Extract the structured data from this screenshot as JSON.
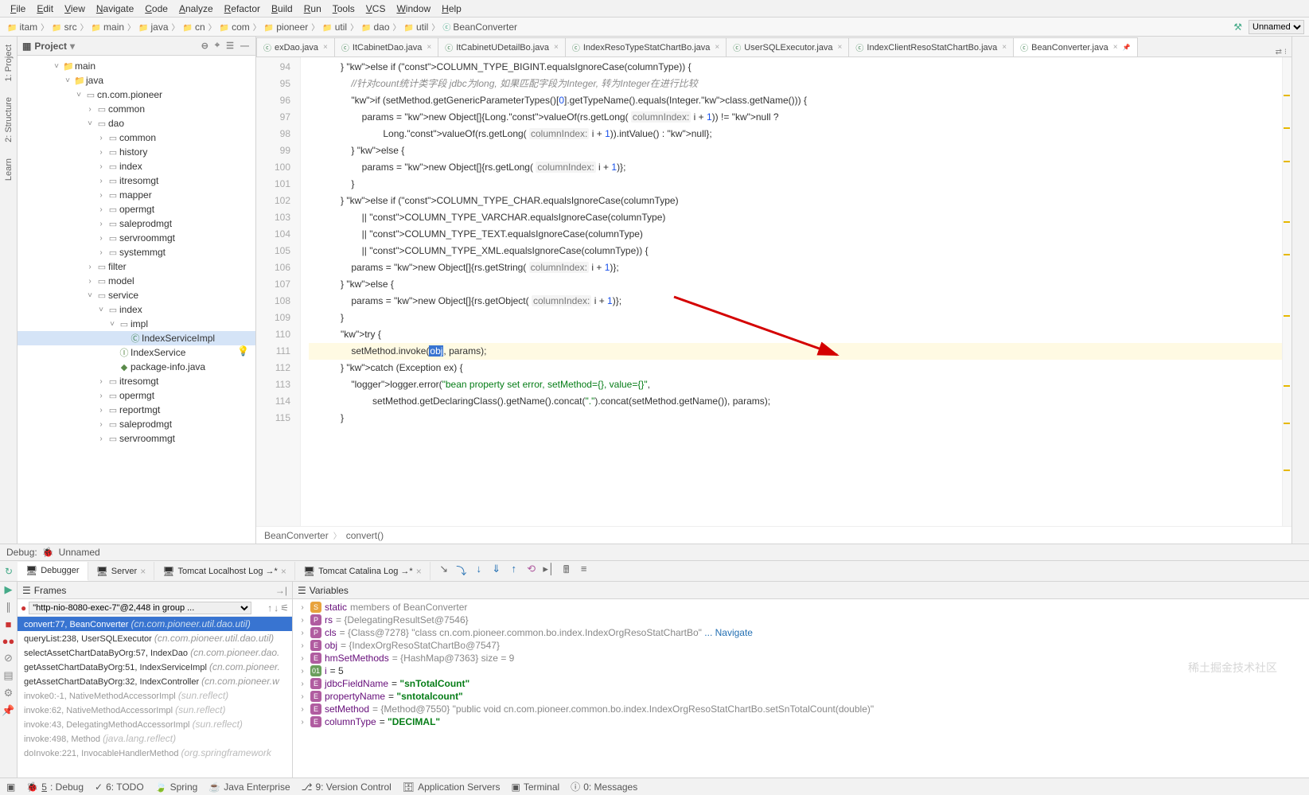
{
  "menu": [
    "File",
    "Edit",
    "View",
    "Navigate",
    "Code",
    "Analyze",
    "Refactor",
    "Build",
    "Run",
    "Tools",
    "VCS",
    "Window",
    "Help"
  ],
  "breadcrumb": {
    "items": [
      {
        "icon": "folder",
        "label": "itam"
      },
      {
        "icon": "folder",
        "label": "src"
      },
      {
        "icon": "folder",
        "label": "main"
      },
      {
        "icon": "folder",
        "label": "java"
      },
      {
        "icon": "folder",
        "label": "cn"
      },
      {
        "icon": "folder",
        "label": "com"
      },
      {
        "icon": "folder",
        "label": "pioneer"
      },
      {
        "icon": "folder",
        "label": "util"
      },
      {
        "icon": "folder",
        "label": "dao"
      },
      {
        "icon": "folder",
        "label": "util"
      },
      {
        "icon": "class",
        "label": "BeanConverter"
      }
    ],
    "run_config": "Unnamed"
  },
  "project": {
    "title": "Project",
    "tree": [
      {
        "depth": 3,
        "exp": "v",
        "ico": "folder",
        "label": "main"
      },
      {
        "depth": 4,
        "exp": "v",
        "ico": "folder",
        "label": "java"
      },
      {
        "depth": 5,
        "exp": "v",
        "ico": "pkg",
        "label": "cn.com.pioneer"
      },
      {
        "depth": 6,
        "exp": ">",
        "ico": "pkg",
        "label": "common"
      },
      {
        "depth": 6,
        "exp": "v",
        "ico": "pkg",
        "label": "dao"
      },
      {
        "depth": 7,
        "exp": ">",
        "ico": "pkg",
        "label": "common"
      },
      {
        "depth": 7,
        "exp": ">",
        "ico": "pkg",
        "label": "history"
      },
      {
        "depth": 7,
        "exp": ">",
        "ico": "pkg",
        "label": "index"
      },
      {
        "depth": 7,
        "exp": ">",
        "ico": "pkg",
        "label": "itresomgt"
      },
      {
        "depth": 7,
        "exp": ">",
        "ico": "pkg",
        "label": "mapper"
      },
      {
        "depth": 7,
        "exp": ">",
        "ico": "pkg",
        "label": "opermgt"
      },
      {
        "depth": 7,
        "exp": ">",
        "ico": "pkg",
        "label": "saleprodmgt"
      },
      {
        "depth": 7,
        "exp": ">",
        "ico": "pkg",
        "label": "servroommgt"
      },
      {
        "depth": 7,
        "exp": ">",
        "ico": "pkg",
        "label": "systemmgt"
      },
      {
        "depth": 6,
        "exp": ">",
        "ico": "pkg",
        "label": "filter"
      },
      {
        "depth": 6,
        "exp": ">",
        "ico": "pkg",
        "label": "model"
      },
      {
        "depth": 6,
        "exp": "v",
        "ico": "pkg",
        "label": "service"
      },
      {
        "depth": 7,
        "exp": "v",
        "ico": "pkg",
        "label": "index"
      },
      {
        "depth": 8,
        "exp": "v",
        "ico": "pkg",
        "label": "impl"
      },
      {
        "depth": 9,
        "exp": "",
        "ico": "class",
        "label": "IndexServiceImpl",
        "sel": true
      },
      {
        "depth": 8,
        "exp": "",
        "ico": "int",
        "label": "IndexService"
      },
      {
        "depth": 8,
        "exp": "",
        "ico": "java",
        "label": "package-info.java"
      },
      {
        "depth": 7,
        "exp": ">",
        "ico": "pkg",
        "label": "itresomgt"
      },
      {
        "depth": 7,
        "exp": ">",
        "ico": "pkg",
        "label": "opermgt"
      },
      {
        "depth": 7,
        "exp": ">",
        "ico": "pkg",
        "label": "reportmgt"
      },
      {
        "depth": 7,
        "exp": ">",
        "ico": "pkg",
        "label": "saleprodmgt"
      },
      {
        "depth": 7,
        "exp": ">",
        "ico": "pkg",
        "label": "servroommgt"
      }
    ]
  },
  "tabs": [
    {
      "label": "exDao.java"
    },
    {
      "label": "ItCabinetDao.java"
    },
    {
      "label": "ItCabinetUDetailBo.java"
    },
    {
      "label": "IndexResoTypeStatChartBo.java"
    },
    {
      "label": "UserSQLExecutor.java"
    },
    {
      "label": "IndexClientResoStatChartBo.java"
    },
    {
      "label": "BeanConverter.java",
      "active": true,
      "pinned": true
    }
  ],
  "code": {
    "first_line": 94,
    "bulb_line": 111,
    "lines": [
      "            } else if (COLUMN_TYPE_BIGINT.equalsIgnoreCase(columnType)) {",
      "                //针对count统计类字段 jdbc为long, 如果匹配字段为Integer, 转为Integer在进行比较",
      "                if (setMethod.getGenericParameterTypes()[0].getTypeName().equals(Integer.class.getName())) {",
      "                    params = new Object[]{Long.valueOf(rs.getLong( columnIndex: i + 1)) != null ?",
      "                            Long.valueOf(rs.getLong( columnIndex: i + 1)).intValue() : null};",
      "                } else {",
      "                    params = new Object[]{rs.getLong( columnIndex: i + 1)};",
      "                }",
      "            } else if (COLUMN_TYPE_CHAR.equalsIgnoreCase(columnType)",
      "                    || COLUMN_TYPE_VARCHAR.equalsIgnoreCase(columnType)",
      "                    || COLUMN_TYPE_TEXT.equalsIgnoreCase(columnType)",
      "                    || COLUMN_TYPE_XML.equalsIgnoreCase(columnType)) {",
      "                params = new Object[]{rs.getString( columnIndex: i + 1)};",
      "            } else {",
      "                params = new Object[]{rs.getObject( columnIndex: i + 1)};",
      "            }",
      "            try {",
      "                setMethod.invoke(obj, params);",
      "            } catch (Exception ex) {",
      "                logger.error(\"bean property set error, setMethod={}, value={}\",",
      "                        setMethod.getDeclaringClass().getName().concat(\".\").concat(setMethod.getName()), params);",
      "            }"
    ]
  },
  "editor_crumb": [
    "BeanConverter",
    "convert()"
  ],
  "left_gutter": [
    "1: Project",
    "2: Structure",
    "Learn"
  ],
  "right_gutter": [],
  "debug": {
    "title": "Debug:",
    "config": "Unnamed",
    "tabs": [
      {
        "label": "Debugger",
        "active": true
      },
      {
        "label": "Server"
      },
      {
        "label": "Tomcat Localhost Log →*"
      },
      {
        "label": "Tomcat Catalina Log →*"
      }
    ],
    "thread": "\"http-nio-8080-exec-7\"@2,448 in group ...",
    "frames_label": "Frames",
    "vars_label": "Variables",
    "frames": [
      {
        "m": "convert:77, BeanConverter",
        "loc": "(cn.com.pioneer.util.dao.util)",
        "sel": true
      },
      {
        "m": "queryList:238, UserSQLExecutor",
        "loc": "(cn.com.pioneer.util.dao.util)"
      },
      {
        "m": "selectAssetChartDataByOrg:57, IndexDao",
        "loc": "(cn.com.pioneer.dao."
      },
      {
        "m": "getAssetChartDataByOrg:51, IndexServiceImpl",
        "loc": "(cn.com.pioneer."
      },
      {
        "m": "getAssetChartDataByOrg:32, IndexController",
        "loc": "(cn.com.pioneer.w"
      },
      {
        "m": "invoke0:-1, NativeMethodAccessorImpl",
        "loc": "(sun.reflect)",
        "lib": true
      },
      {
        "m": "invoke:62, NativeMethodAccessorImpl",
        "loc": "(sun.reflect)",
        "lib": true
      },
      {
        "m": "invoke:43, DelegatingMethodAccessorImpl",
        "loc": "(sun.reflect)",
        "lib": true
      },
      {
        "m": "invoke:498, Method",
        "loc": "(java.lang.reflect)",
        "lib": true
      },
      {
        "m": "doInvoke:221, InvocableHandlerMethod",
        "loc": "(org.springframework",
        "lib": true
      }
    ],
    "vars": [
      {
        "badge": "S",
        "name": "static",
        "rest": " members of BeanConverter",
        "grey": true
      },
      {
        "badge": "P",
        "name": "rs",
        "rest": " = {DelegatingResultSet@7546}",
        "grey": true
      },
      {
        "badge": "P",
        "name": "cls",
        "rest": " = {Class@7278} \"class cn.com.pioneer.common.bo.index.IndexOrgResoStatChartBo\" ",
        "link": "... Navigate",
        "grey": true
      },
      {
        "badge": "E",
        "name": "obj",
        "rest": " = {IndexOrgResoStatChartBo@7547}",
        "grey": true
      },
      {
        "badge": "E",
        "name": "hmSetMethods",
        "rest": " = {HashMap@7363}  size = 9",
        "grey": true
      },
      {
        "badge": "01",
        "name": "i",
        "rest": " = 5"
      },
      {
        "badge": "E",
        "name": "jdbcFieldName",
        "rest": " = ",
        "str": "\"snTotalCount\""
      },
      {
        "badge": "E",
        "name": "propertyName",
        "rest": " = ",
        "str": "\"sntotalcount\""
      },
      {
        "badge": "E",
        "name": "setMethod",
        "rest": " = {Method@7550} \"public void cn.com.pioneer.common.bo.index.IndexOrgResoStatChartBo.setSnTotalCount(double)\"",
        "grey": true
      },
      {
        "badge": "E",
        "name": "columnType",
        "rest": " = ",
        "str": "\"DECIMAL\""
      }
    ]
  },
  "statusbar": {
    "items": [
      {
        "icon": "🐞",
        "label": "5: Debug",
        "u": true
      },
      {
        "icon": "✓",
        "label": "6: TODO"
      },
      {
        "icon": "🍃",
        "label": "Spring"
      },
      {
        "icon": "☕",
        "label": "Java Enterprise"
      },
      {
        "icon": "⎇",
        "label": "9: Version Control"
      },
      {
        "icon": "🗄",
        "label": "Application Servers"
      },
      {
        "icon": "▣",
        "label": "Terminal"
      },
      {
        "icon": "ⓘ",
        "label": "0: Messages"
      }
    ]
  },
  "watermark": "稀土掘金技术社区"
}
